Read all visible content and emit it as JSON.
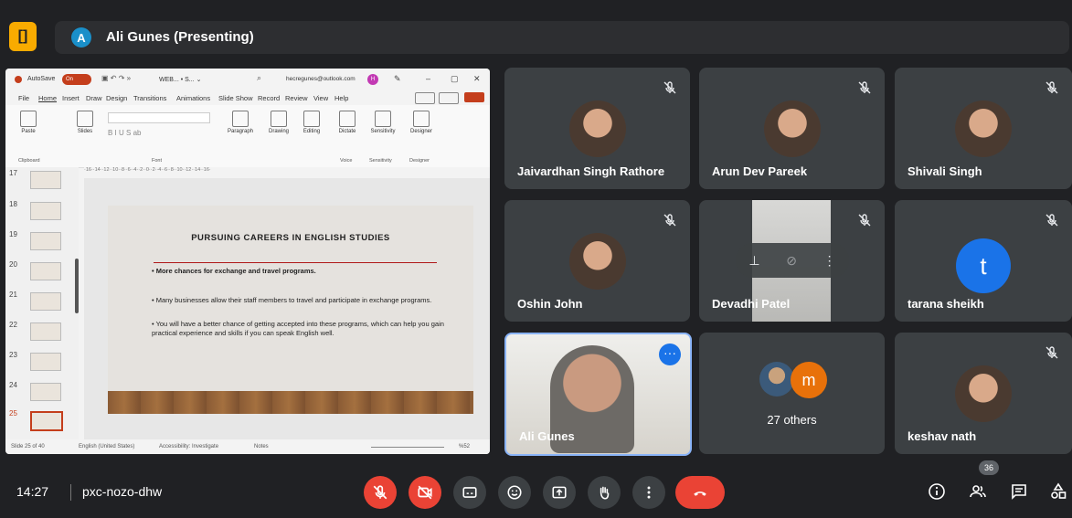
{
  "header": {
    "logo_glyph": "[]",
    "presenter_initial": "A",
    "presenter_label": "Ali Gunes (Presenting)"
  },
  "ppt": {
    "autosave": "AutoSave",
    "autosave_state": "On",
    "filename": "WEB... • S... ⌄",
    "account": "hecregunes@outlook.com",
    "account_initial": "H",
    "menu": [
      "File",
      "Home",
      "Insert",
      "Draw",
      "Design",
      "Transitions",
      "Animations",
      "Slide Show",
      "Record",
      "Review",
      "View",
      "Help"
    ],
    "ribbon": {
      "paste": "Paste",
      "slides": "Slides",
      "paragraph": "Paragraph",
      "drawing": "Drawing",
      "editing": "Editing",
      "dictate": "Dictate",
      "sensitivity": "Sensitivity",
      "designer": "Designer"
    },
    "groups": {
      "clipboard": "Clipboard",
      "font": "Font",
      "voice": "Voice",
      "sensitivity": "Sensitivity",
      "designer": "Designer"
    },
    "ruler": "·16··14··12··10··8··6··4··2··0··2··4··6··8··10··12··14··16·",
    "slide_numbers": [
      "17",
      "18",
      "19",
      "20",
      "21",
      "22",
      "23",
      "24",
      "25"
    ],
    "slide": {
      "title": "PURSUING CAREERS IN ENGLISH STUDIES",
      "bullets": [
        "• More chances for exchange and travel programs.",
        "• Many businesses allow their staff members to travel and participate in exchange programs.",
        "• You will have a better chance of getting accepted into these programs, which can help you gain practical experience and skills if you can speak English well."
      ]
    },
    "status": {
      "slide": "Slide 25 of 40",
      "language": "English (United States)",
      "accessibility": "Accessibility: Investigate",
      "notes": "Notes",
      "zoom": "%52"
    }
  },
  "participants": [
    {
      "name": "Jaivardhan Singh Rathore"
    },
    {
      "name": "Arun Dev Pareek"
    },
    {
      "name": "Shivali Singh"
    },
    {
      "name": "Oshin John"
    },
    {
      "name": "Devadhi Patel"
    },
    {
      "name": "tarana sheikh",
      "initial": "t"
    },
    {
      "name": "Ali Gunes"
    },
    {
      "name": "27 others",
      "initial": "m"
    },
    {
      "name": "keshav nath"
    }
  ],
  "footer": {
    "time": "14:27",
    "meeting_code": "pxc-nozo-dhw",
    "people_count": "36"
  },
  "colors": {
    "red": "#ea4335",
    "tile": "#3c4043",
    "bg": "#202124",
    "accent": "#1a73e8"
  }
}
